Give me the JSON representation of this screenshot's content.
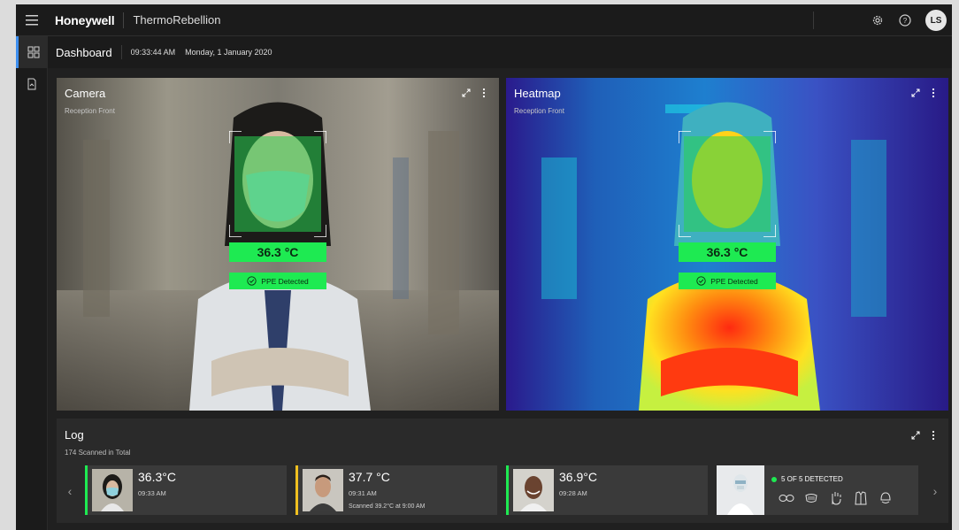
{
  "topbar": {
    "brand": "Honeywell",
    "app_name": "ThermoRebellion",
    "user_initials": "LS"
  },
  "subheader": {
    "title": "Dashboard",
    "time": "09:33:44 AM",
    "date": "Monday, 1 January 2020"
  },
  "camera": {
    "title": "Camera",
    "subtitle": "Reception Front",
    "temperature": "36.3 °C",
    "ppe": "PPE Detected"
  },
  "heatmap": {
    "title": "Heatmap",
    "subtitle": "Reception Front",
    "temperature": "36.3 °C",
    "ppe": "PPE Detected"
  },
  "log": {
    "title": "Log",
    "subtitle": "174 Scanned in Total",
    "entries": [
      {
        "temperature": "36.3°C",
        "time": "09:33 AM",
        "note": "",
        "status_color": "#1eea52"
      },
      {
        "temperature": "37.7 °C",
        "time": "09:31 AM",
        "note": "Scanned 39.2°C at 9:00 AM",
        "status_color": "#f0c020"
      },
      {
        "temperature": "36.9°C",
        "time": "09:28 AM",
        "note": "",
        "status_color": "#1eea52"
      }
    ],
    "ppe_card": {
      "status": "5 OF 5 DETECTED",
      "status_color": "#1eea52",
      "icons": [
        "goggles-icon",
        "mask-icon",
        "glove-icon",
        "gown-icon",
        "cap-icon"
      ]
    }
  },
  "colors": {
    "accent": "#3d8ff0",
    "ok": "#1eea52",
    "warn": "#f0c020"
  }
}
